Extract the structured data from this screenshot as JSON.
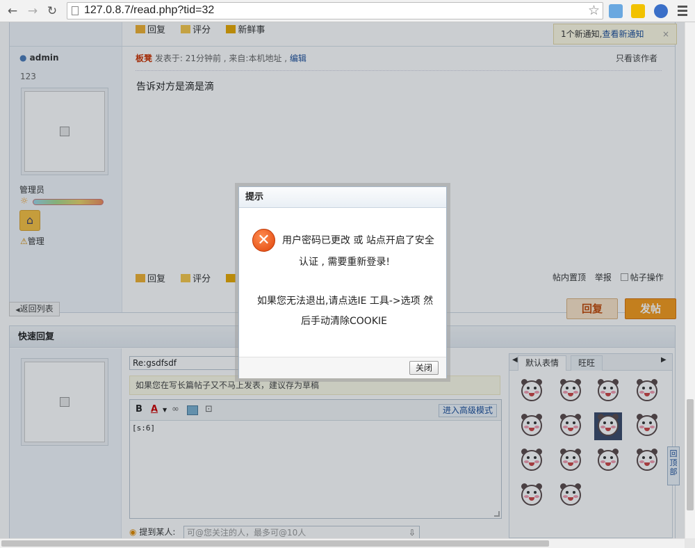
{
  "browser": {
    "url": "127.0.8.7/read.php?tid=32"
  },
  "notification": {
    "count_text": "1个新通知,",
    "link_text": "查看新通知",
    "close": "×"
  },
  "post_actions_top": [
    "回复",
    "评分",
    "新鲜事"
  ],
  "post_actions_bottom": [
    "回复",
    "评分",
    "新"
  ],
  "user": {
    "name": "admin",
    "id": "123",
    "role": "管理员",
    "manage_label": "管理"
  },
  "post": {
    "author": "板凳",
    "meta": " 发表于: 21分钟前 , 来自:本机地址 , ",
    "edit": "编辑",
    "only_author": "只看该作者",
    "body": "告诉对方是滴是滴",
    "tools": [
      "帖内置顶",
      "举报",
      "帖子操作"
    ]
  },
  "buttons": {
    "back": "返回列表",
    "reply": "回复",
    "post": "发帖"
  },
  "quick_reply": {
    "header": "快速回复",
    "title_value": "Re:gsdfsdf",
    "draft_tip": "如果您在写长篇帖子又不马上发表，建议存为草稿",
    "advanced_mode": "进入高级模式",
    "editor_content": "[s:6]",
    "mention_label": "提到某人:",
    "mention_placeholder": "可@您关注的人，最多可@10人"
  },
  "emoji": {
    "tabs": [
      "默认表情",
      "旺旺"
    ]
  },
  "to_top": "回顶部",
  "modal": {
    "title": "提示",
    "line1": "用户密码已更改 或 站点开启了安全",
    "line2": "认证 , 需要重新登录!",
    "line3": "如果您无法退出,请点选IE 工具->选项 然",
    "line4": "后手动清除COOKIE",
    "close": "关闭"
  }
}
